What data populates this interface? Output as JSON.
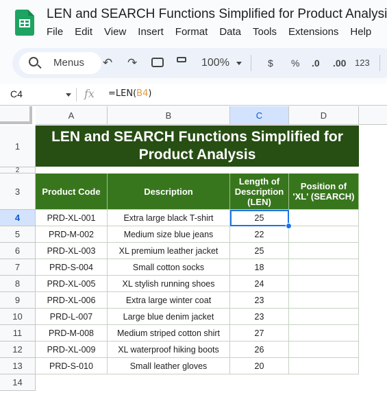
{
  "app": {
    "document_title": "LEN and SEARCH Functions Simplified for Product Analysis",
    "logo_icon": "google-sheets-logo",
    "menu": [
      "File",
      "Edit",
      "View",
      "Insert",
      "Format",
      "Data",
      "Tools",
      "Extensions",
      "Help"
    ]
  },
  "toolbar": {
    "search_label": "Menus",
    "undo_icon": "↶",
    "redo_icon": "↷",
    "print_icon": "🖶",
    "paint_format_icon": "paint-roller",
    "zoom": "100%",
    "currency": "$",
    "percent": "%",
    "decrease_decimal": ".0",
    "increase_decimal": ".00",
    "number_format": "123"
  },
  "formula_bar": {
    "name_box": "C4",
    "fx_label": "fx",
    "formula_prefix": "=LEN(",
    "formula_ref": "B4",
    "formula_suffix": ")"
  },
  "columns": [
    "A",
    "B",
    "C",
    "D"
  ],
  "selected_column": "C",
  "rows": [
    "1",
    "2",
    "3",
    "4",
    "5",
    "6",
    "7",
    "8",
    "9",
    "10",
    "11",
    "12",
    "13",
    "14"
  ],
  "selected_row": "4",
  "sheet": {
    "banner": "LEN and SEARCH Functions Simplified for Product Analysis",
    "headers": [
      "Product Code",
      "Description",
      "Length of Description (LEN)",
      "Position of 'XL' (SEARCH)"
    ],
    "data": [
      {
        "code": "PRD-XL-001",
        "description": "Extra large black T-shirt",
        "len": "25",
        "search": ""
      },
      {
        "code": "PRD-M-002",
        "description": "Medium size blue jeans",
        "len": "22",
        "search": ""
      },
      {
        "code": "PRD-XL-003",
        "description": "XL premium leather jacket",
        "len": "25",
        "search": ""
      },
      {
        "code": "PRD-S-004",
        "description": "Small cotton socks",
        "len": "18",
        "search": ""
      },
      {
        "code": "PRD-XL-005",
        "description": "XL stylish running shoes",
        "len": "24",
        "search": ""
      },
      {
        "code": "PRD-XL-006",
        "description": "Extra large winter coat",
        "len": "23",
        "search": ""
      },
      {
        "code": "PRD-L-007",
        "description": "Large blue denim jacket",
        "len": "23",
        "search": ""
      },
      {
        "code": "PRD-M-008",
        "description": "Medium striped cotton shirt",
        "len": "27",
        "search": ""
      },
      {
        "code": "PRD-XL-009",
        "description": "XL waterproof hiking boots",
        "len": "26",
        "search": ""
      },
      {
        "code": "PRD-S-010",
        "description": "Small leather gloves",
        "len": "20",
        "search": ""
      }
    ]
  },
  "colors": {
    "banner_bg": "#274e13",
    "header_bg": "#38761d",
    "selection": "#1a73e8",
    "selected_header_bg": "#d3e3fd"
  }
}
